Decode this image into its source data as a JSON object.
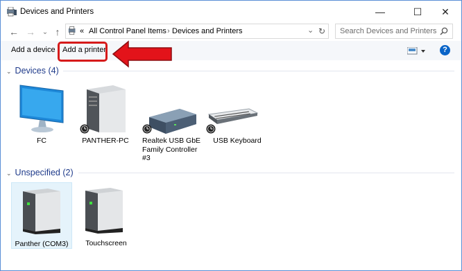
{
  "window": {
    "title": "Devices and Printers",
    "minimize_glyph": "—",
    "maximize_glyph": "☐",
    "close_glyph": "✕"
  },
  "address_bar": {
    "back_glyph": "←",
    "forward_glyph": "→",
    "recent_glyph": "⌄",
    "up_glyph": "↑",
    "overflow": "«",
    "breadcrumb_1": "All Control Panel Items",
    "separator": "›",
    "breadcrumb_2": "Devices and Printers",
    "dropdown_glyph": "⌄",
    "refresh_glyph": "↻",
    "search_placeholder": "Search Devices and Printers",
    "search_icon": "magnifier-icon"
  },
  "toolbar": {
    "add_device": "Add a device",
    "add_printer": "Add a printer",
    "view_icon": "view-options-icon",
    "help_glyph": "?"
  },
  "annotation": {
    "color": "#e3131a",
    "type": "arrow-pointing-left"
  },
  "groups": [
    {
      "title": "Devices (4)",
      "devices": [
        {
          "label": "FC",
          "icon": "monitor-icon"
        },
        {
          "label": "PANTHER-PC",
          "icon": "pc-tower-icon"
        },
        {
          "label_line1": "Realtek USB GbE",
          "label_line2": "Family Controller",
          "label_line3": "#3",
          "icon": "network-adapter-icon"
        },
        {
          "label": "USB Keyboard",
          "icon": "keyboard-icon"
        }
      ]
    },
    {
      "title": "Unspecified (2)",
      "devices": [
        {
          "label": "Panther (COM3)",
          "icon": "device-box-icon",
          "selected": true
        },
        {
          "label": "Touchscreen",
          "icon": "device-box-icon"
        }
      ]
    }
  ],
  "colors": {
    "group_header": "#1e3a8a",
    "accent": "#0a64c8",
    "selection": "#e5f3fb"
  }
}
